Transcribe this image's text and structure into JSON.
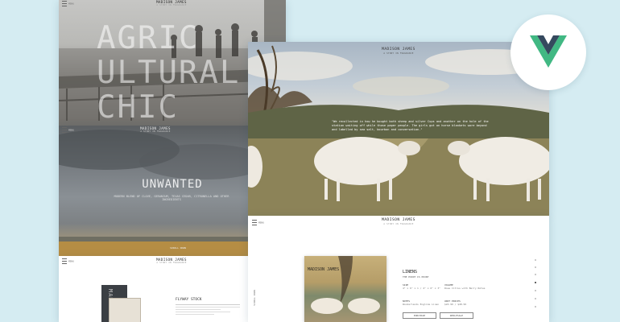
{
  "agri": {
    "menu_label": "MENU",
    "brand": "MADISON JAMES",
    "subtitle": "A STORY IN FRAGRANCE",
    "headline_lines": [
      "AGRIC",
      "ULTURAL",
      "CHIC"
    ]
  },
  "unwanted": {
    "menu_label": "MENU",
    "brand": "MADISON JAMES",
    "subtitle": "A STORY IN FRAGRANCE",
    "title": "UNWANTED",
    "description_line1": "MODERN BLEND OF CLOVE, GERANIUM, TEXAS CEDAR, CITRONELLA AND OTHER",
    "description_line2": "INGREDIENTS",
    "scroll_label": "SCROLL DOWN"
  },
  "flyway": {
    "menu_label": "MENU",
    "brand": "MADISON JAMES",
    "subtitle": "A STORY IN FRAGRANCE",
    "product_title": "FLYWAY STOCK",
    "side_text": "MADISON"
  },
  "sheep": {
    "brand": "MADISON JAMES",
    "subtitle": "A STORY IN FRAGRANCE",
    "quote": "\"We recollected in how he bought both sheep and silver Cups and another on the hole of the station waiting off while those paper people. The girls got on horse blankets wore beyond and labelled by sea salt, bourbon and conversation.\""
  },
  "product": {
    "menu_label": "MENU",
    "brand": "MADISON JAMES",
    "subtitle": "A STORY IN FRAGRANCE",
    "card_brand": "MADISON JAMES",
    "name": "LINENS",
    "tagline": "THE POINT IS POINT",
    "fields": [
      {
        "label": "SIZE",
        "value": "4\" x 6\" x 1 / 4\" x 6\" x 3\""
      },
      {
        "label": "VOLUME",
        "value": "Rose Citrus with Berry Notes"
      },
      {
        "label": "NOTES",
        "value": "Wonderlands Englike Linen"
      },
      {
        "label": "UNIT PRICES",
        "value": "$24.99 / $48.99"
      }
    ],
    "btn_primary": "PURCHASE",
    "btn_secondary": "WHOLESALE",
    "side_text": "SCROLL DOWN"
  },
  "colors": {
    "background": "#d5ecf2",
    "vue_green": "#41b883",
    "vue_dark": "#35495e"
  },
  "icons": [
    "menu-icon",
    "vue-logo"
  ]
}
